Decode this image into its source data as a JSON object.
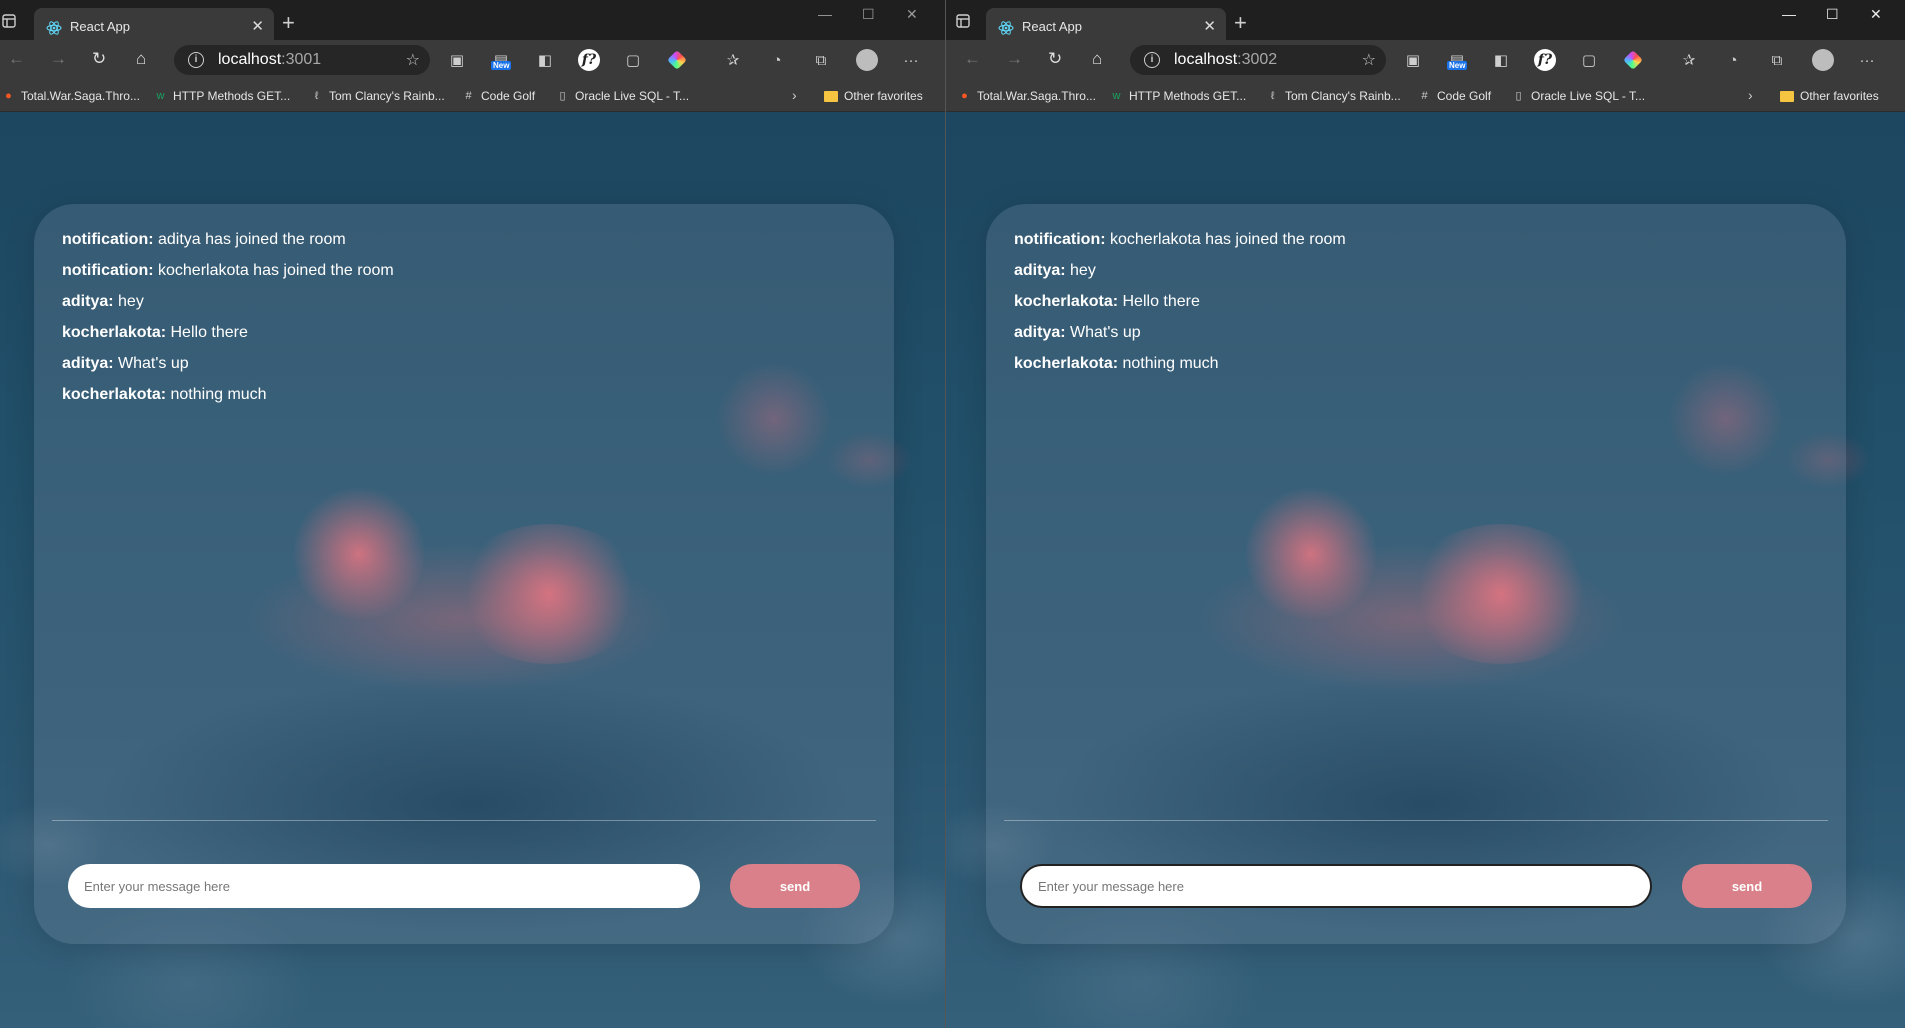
{
  "windows": [
    {
      "tab": {
        "title": "React App",
        "close": "✕"
      },
      "address": {
        "host": "localhost",
        "port": ":3001"
      },
      "bookmarks": [
        {
          "label": "Total.War.Saga.Thro..."
        },
        {
          "label": "HTTP Methods GET..."
        },
        {
          "label": "Tom Clancy's Rainb..."
        },
        {
          "label": "Code Golf"
        },
        {
          "label": "Oracle Live SQL - T..."
        }
      ],
      "other_favorites": "Other favorites",
      "messages": [
        {
          "user": "notification:",
          "text": "aditya has joined the room"
        },
        {
          "user": "notification:",
          "text": "kocherlakota has joined the room"
        },
        {
          "user": "aditya:",
          "text": "hey"
        },
        {
          "user": "kocherlakota:",
          "text": "Hello there"
        },
        {
          "user": "aditya:",
          "text": "What's up"
        },
        {
          "user": "kocherlakota:",
          "text": "nothing much"
        }
      ],
      "input": {
        "placeholder": "Enter your message here",
        "value": ""
      },
      "send_label": "send"
    },
    {
      "tab": {
        "title": "React App",
        "close": "✕"
      },
      "address": {
        "host": "localhost",
        "port": ":3002"
      },
      "bookmarks": [
        {
          "label": "Total.War.Saga.Thro..."
        },
        {
          "label": "HTTP Methods GET..."
        },
        {
          "label": "Tom Clancy's Rainb..."
        },
        {
          "label": "Code Golf"
        },
        {
          "label": "Oracle Live SQL - T..."
        }
      ],
      "other_favorites": "Other favorites",
      "messages": [
        {
          "user": "notification:",
          "text": "kocherlakota has joined the room"
        },
        {
          "user": "aditya:",
          "text": "hey"
        },
        {
          "user": "kocherlakota:",
          "text": "Hello there"
        },
        {
          "user": "aditya:",
          "text": "What's up"
        },
        {
          "user": "kocherlakota:",
          "text": "nothing much"
        }
      ],
      "input": {
        "placeholder": "Enter your message here",
        "value": ""
      },
      "send_label": "send"
    }
  ],
  "toolbar": {
    "new_badge": "New",
    "ext_f": "f?",
    "more": "···",
    "chevron": "›"
  },
  "colors": {
    "accent_send": "#d9808a",
    "background_top": "#1d4660",
    "card": "rgba(120,140,160,0.28)"
  }
}
